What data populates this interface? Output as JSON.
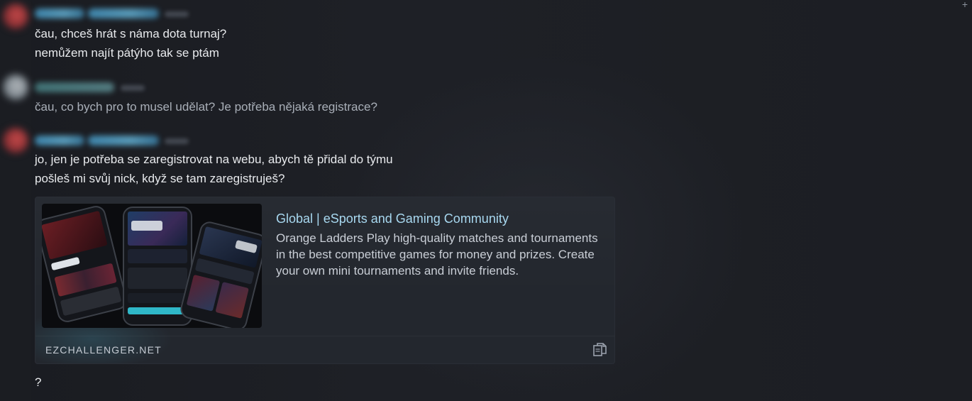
{
  "messages": [
    {
      "author_blurred": true,
      "lines": [
        "čau, chceš hrát s náma dota turnaj?",
        "nemůžem najít pátýho tak se ptám"
      ]
    },
    {
      "author_blurred": true,
      "lines": [
        "čau, co bych pro to musel udělat? Je potřeba nějaká registrace?"
      ]
    },
    {
      "author_blurred": true,
      "lines": [
        "jo, jen je potřeba se zaregistrovat na webu, abych tě přidal do týmu",
        "pošleš mi svůj nick, když se tam zaregistruješ?"
      ]
    },
    {
      "author_blurred": true,
      "lines": [
        "?"
      ]
    }
  ],
  "embed": {
    "title": "Global | eSports and Gaming Community",
    "description": "Orange Ladders Play high-quality matches and tournaments in the best competitive games for money and prizes. Create your own mini tournaments and invite friends.",
    "domain": "EZCHALLENGER.NET",
    "image_icon": "app-mockup-phones",
    "copy_icon": "copy-icon"
  },
  "colors": {
    "background": "#1d1f24",
    "link": "#a8d8f0",
    "text": "#e8eaed",
    "dim_text": "#a9afb8"
  }
}
